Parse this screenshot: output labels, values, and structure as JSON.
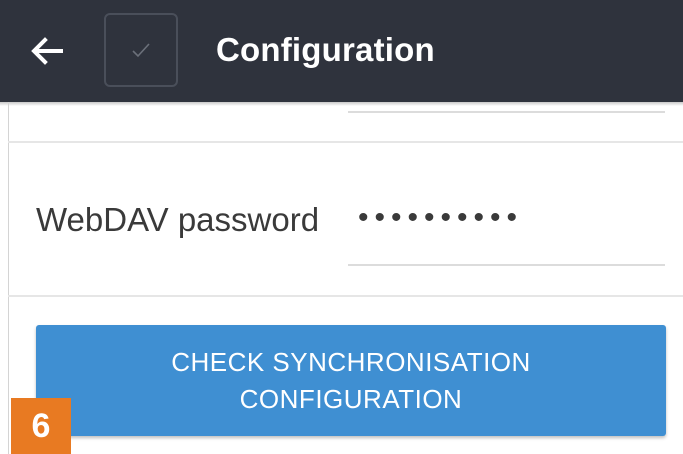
{
  "appbar": {
    "title": "Configuration",
    "back_icon": "arrow-left-icon",
    "check_icon": "checkmark-icon",
    "background": "#2f333d"
  },
  "form": {
    "password_label": "WebDAV password",
    "password_value": "••••••••••"
  },
  "actions": {
    "check_sync_label": "CHECK SYNCHRONISATION CONFIGURATION",
    "accent": "#3f8fd2"
  },
  "badge": {
    "number": "6",
    "color": "#e87a22"
  }
}
